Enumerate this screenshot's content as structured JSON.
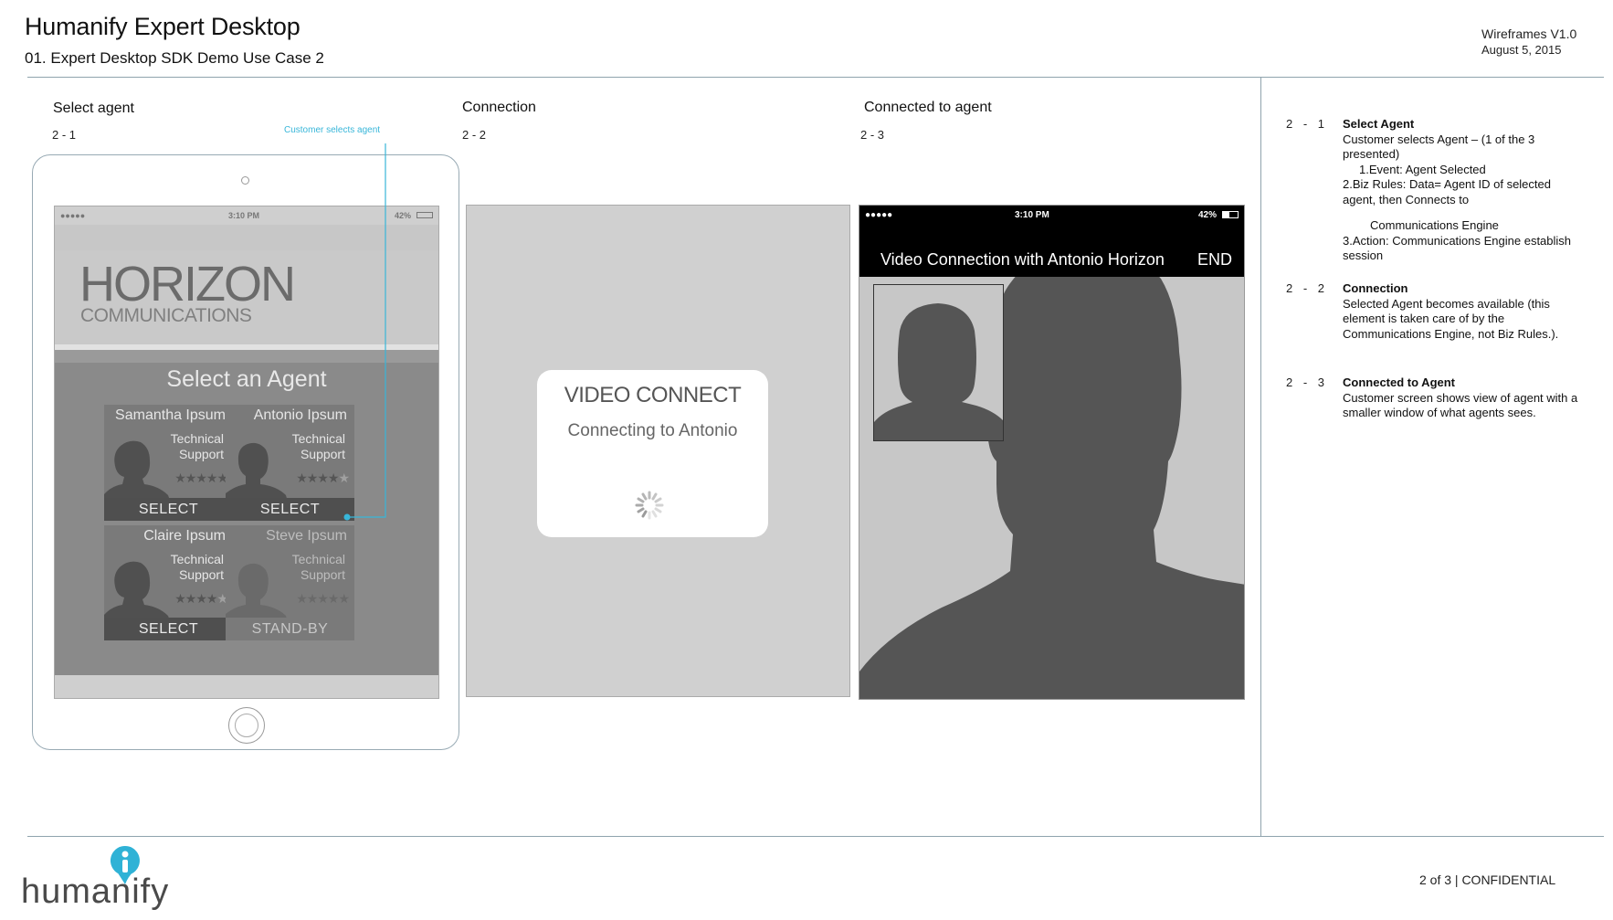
{
  "header": {
    "title": "Humanify Expert Desktop",
    "subtitle": "01. Expert Desktop SDK Demo Use Case 2",
    "version": "Wireframes V1.0",
    "date": "August 5, 2015"
  },
  "steps": [
    {
      "title": "Select agent",
      "num": "2 - 1"
    },
    {
      "title": "Connection",
      "num": "2 - 2"
    },
    {
      "title": "Connected to agent",
      "num": "2 - 3"
    }
  ],
  "callout": "Customer selects agent",
  "screen1": {
    "status": {
      "signal": "●●●●● ",
      "time": "3:10 PM",
      "battery": "42%"
    },
    "brand_big": "HORIZON",
    "brand_small": "COMMUNICATIONS",
    "heading": "Select an Agent",
    "agents": [
      {
        "name": "Samantha Ipsum",
        "role": "Technical\nSupport",
        "stars_on": "★★★★★",
        "stars_off": "",
        "button": "SELECT"
      },
      {
        "name": "Antonio Ipsum",
        "role": "Technical\nSupport",
        "stars_on": "★★★★",
        "stars_off": "★",
        "button": "SELECT"
      },
      {
        "name": "Claire Ipsum",
        "role": "Technical\nSupport",
        "stars_on": "★★★★",
        "stars_off": "★",
        "button": "SELECT"
      },
      {
        "name": "Steve Ipsum",
        "role": "Technical\nSupport",
        "stars_on": "★★★★★",
        "stars_off": "",
        "button": "STAND-BY"
      }
    ]
  },
  "screen2": {
    "title": "VIDEO CONNECT",
    "subtitle": "Connecting to Antonio"
  },
  "screen3": {
    "status": {
      "signal": "●●●●● ",
      "time": "3:10 PM",
      "battery": "42%"
    },
    "title": "Video Connection with Antonio Horizon",
    "end": "END"
  },
  "notes": [
    {
      "num": "2 - 1",
      "heading": "Select Agent",
      "lines": [
        "Customer selects Agent – (1 of the 3 presented)",
        "1.Event: Agent Selected",
        "2.Biz Rules: Data= Agent ID of selected agent, then Connects to",
        "Communications Engine",
        "3.Action: Communications Engine establish session"
      ]
    },
    {
      "num": "2 - 2",
      "heading": "Connection",
      "lines": [
        "Selected Agent becomes available (this element is taken care of by the Communications Engine, not Biz Rules.)."
      ]
    },
    {
      "num": "2 - 3",
      "heading": "Connected to Agent",
      "lines": [
        "Customer screen shows view of agent with a smaller window of what agents sees."
      ]
    }
  ],
  "footer": {
    "logo": "humanify",
    "confidential": "2 of 3 | CONFIDENTIAL"
  },
  "colors": {
    "accent": "#38b6d9",
    "rule": "#8fa3ad"
  }
}
